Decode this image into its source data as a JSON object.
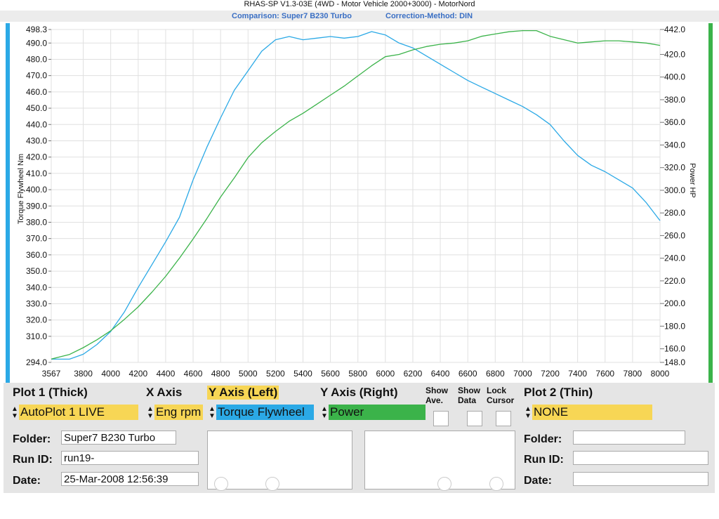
{
  "header": {
    "title": "RHAS-SP V1.3-03E  (4WD - Motor Vehicle 2000+3000) - MotorNord",
    "comparison": "Comparison: Super7 B230 Turbo",
    "correction": "Correction-Method: DIN"
  },
  "chart_data": {
    "type": "line",
    "xlabel": "",
    "ylabel": "Torque Flywheel Nm",
    "y2label": "Power HP",
    "xlim": [
      3567,
      8000
    ],
    "ylim": [
      294.0,
      498.3
    ],
    "y2lim": [
      148.0,
      442.0
    ],
    "x_ticks": [
      "3567",
      "3800",
      "4000",
      "4200",
      "4400",
      "4600",
      "4800",
      "5000",
      "5200",
      "5400",
      "5600",
      "5800",
      "6000",
      "6200",
      "6400",
      "6600",
      "6800",
      "7000",
      "7200",
      "7400",
      "7600",
      "7800",
      "8000"
    ],
    "y_ticks": [
      "294.0",
      "310.0",
      "320.0",
      "330.0",
      "340.0",
      "350.0",
      "360.0",
      "370.0",
      "380.0",
      "390.0",
      "400.0",
      "410.0",
      "420.0",
      "430.0",
      "440.0",
      "450.0",
      "460.0",
      "470.0",
      "480.0",
      "490.0",
      "498.3"
    ],
    "y2_ticks": [
      "148.0",
      "160.0",
      "180.0",
      "200.0",
      "220.0",
      "240.0",
      "260.0",
      "280.0",
      "300.0",
      "320.0",
      "340.0",
      "360.0",
      "380.0",
      "400.0",
      "420.0",
      "442.0"
    ],
    "grid": true,
    "series": [
      {
        "name": "Torque Flywheel",
        "axis": "left",
        "color": "#2ba9e6",
        "x": [
          3567,
          3700,
          3800,
          3900,
          4000,
          4100,
          4200,
          4300,
          4400,
          4500,
          4600,
          4700,
          4800,
          4900,
          5000,
          5100,
          5200,
          5300,
          5400,
          5500,
          5600,
          5700,
          5800,
          5900,
          6000,
          6100,
          6200,
          6300,
          6400,
          6500,
          6600,
          6700,
          6800,
          6900,
          7000,
          7100,
          7200,
          7300,
          7400,
          7500,
          7600,
          7700,
          7800,
          7900,
          8000
        ],
        "y": [
          296,
          296,
          299,
          305,
          313,
          325,
          340,
          354,
          368,
          383,
          406,
          426,
          444,
          461,
          473,
          485,
          492,
          494,
          492,
          493,
          494,
          493,
          494,
          497,
          495,
          490,
          487,
          482,
          477,
          472,
          467,
          463,
          459,
          455,
          451,
          446,
          440,
          430,
          421,
          415,
          411,
          406,
          401,
          392,
          381
        ]
      },
      {
        "name": "Power",
        "axis": "right",
        "color": "#3bb34a",
        "x": [
          3567,
          3700,
          3800,
          3900,
          4000,
          4100,
          4200,
          4300,
          4400,
          4500,
          4600,
          4700,
          4800,
          4900,
          5000,
          5100,
          5200,
          5300,
          5400,
          5500,
          5600,
          5700,
          5800,
          5900,
          6000,
          6100,
          6200,
          6300,
          6400,
          6500,
          6600,
          6700,
          6800,
          6900,
          7000,
          7100,
          7200,
          7300,
          7400,
          7500,
          7600,
          7700,
          7800,
          7900,
          8000
        ],
        "y": [
          151,
          155,
          161,
          168,
          176,
          186,
          197,
          210,
          224,
          240,
          257,
          275,
          294,
          311,
          329,
          342,
          352,
          361,
          368,
          376,
          384,
          392,
          401,
          410,
          418,
          420,
          424,
          427,
          429,
          430,
          432,
          436,
          438,
          440,
          441,
          441,
          436,
          433,
          430,
          431,
          432,
          432,
          431,
          430,
          428
        ]
      }
    ]
  },
  "panel": {
    "plot1_header": "Plot 1 (Thick)",
    "xaxis_header": "X Axis",
    "yleft_header": "Y Axis (Left)",
    "yright_header": "Y Axis (Right)",
    "show_ave_label": "Show Ave.",
    "show_data_label": "Show Data",
    "lock_cursor_label": "Lock Cursor",
    "plot2_header": "Plot 2 (Thin)",
    "plot1_value": "AutoPlot 1 LIVE",
    "xaxis_value": "Eng rpm",
    "yleft_value": "Torque Flywheel",
    "yright_value": "Power",
    "plot2_value": "NONE",
    "folder_label": "Folder:",
    "runid_label": "Run ID:",
    "date_label": "Date:",
    "folder1": "Super7 B230 Turbo",
    "runid1": "run19-",
    "date1": "25-Mar-2008  12:56:39",
    "folder2": "",
    "runid2": "",
    "date2": "",
    "colors": {
      "yellow": "#f7d655",
      "blue": "#2ba9e6",
      "green": "#3bb34a"
    }
  }
}
